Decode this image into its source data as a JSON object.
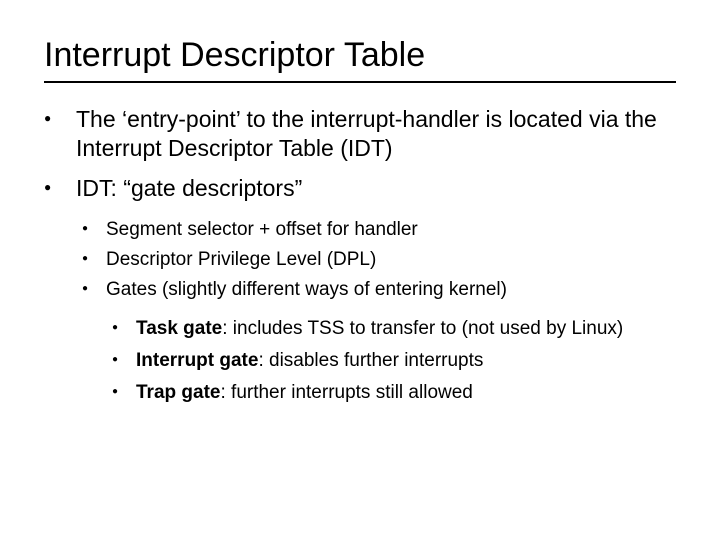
{
  "title": "Interrupt Descriptor Table",
  "bullets": {
    "l1_0": "The ‘entry-point’ to the interrupt-handler is located via the Interrupt Descriptor Table (IDT)",
    "l1_1": "IDT: “gate descriptors”",
    "l2_0": "Segment selector + offset for handler",
    "l2_1": "Descriptor Privilege Level (DPL)",
    "l2_2": "Gates (slightly different ways of entering kernel)",
    "l3_0_lead": "Task gate",
    "l3_0_rest": ": includes TSS to transfer to (not used by Linux)",
    "l3_1_lead": "Interrupt gate",
    "l3_1_rest": ": disables further interrupts",
    "l3_2_lead": "Trap gate",
    "l3_2_rest": ": further interrupts still allowed"
  }
}
